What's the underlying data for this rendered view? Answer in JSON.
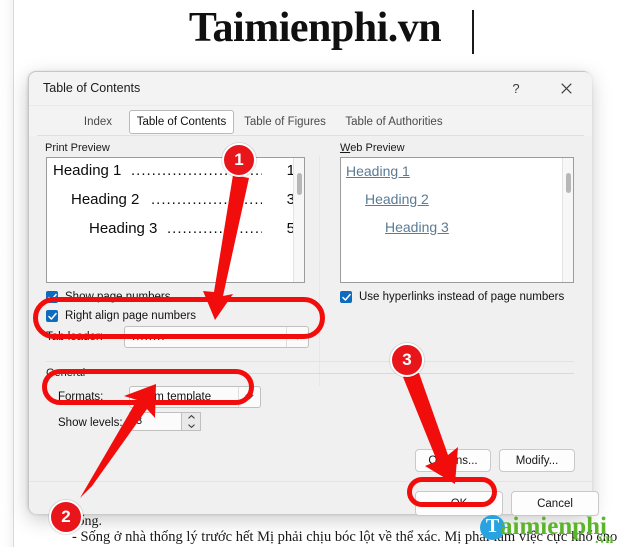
{
  "document": {
    "title": "Taimienphi.vn",
    "line1": "sống.",
    "line2": "- Sống ở nhà thống lý trước hết Mị phải chịu bóc lột về thể xác. Mị phải làm việc cực khổ cho"
  },
  "watermark": {
    "letter": "T",
    "name": "aimienphi",
    "tld": ".vn",
    "circle_color": "#29a3e0",
    "text_color": "#5bb52a"
  },
  "dialog": {
    "title": "Table of Contents",
    "help_icon": "question-mark-icon",
    "close_icon": "close-icon",
    "tabs": [
      {
        "label": "Index",
        "selected": false
      },
      {
        "label": "Table of Contents",
        "selected": true
      },
      {
        "label": "Table of Figures",
        "selected": false
      },
      {
        "label": "Table of Authorities",
        "selected": false
      }
    ],
    "print_preview": {
      "label": "Print Preview",
      "rows": [
        {
          "heading": "Heading 1",
          "dots": "...........................",
          "page": "1"
        },
        {
          "heading": "Heading 2",
          "dots": "........................",
          "page": "3"
        },
        {
          "heading": "Heading 3",
          "dots": ".....................",
          "page": "5"
        }
      ]
    },
    "web_preview": {
      "label": "Web Preview",
      "rows": [
        "Heading 1",
        "Heading 2",
        "Heading 3"
      ]
    },
    "checkboxes": {
      "show_page_numbers": {
        "label": "Show page numbers",
        "checked": true
      },
      "right_align_page_numbers": {
        "label": "Right align page numbers",
        "checked": true
      },
      "use_hyperlinks": {
        "label": "Use hyperlinks instead of page numbers",
        "checked": true
      }
    },
    "tab_leader": {
      "label": "Tab leader:",
      "value": "........"
    },
    "general": {
      "group_label": "General",
      "formats_label": "Formats:",
      "formats_value": "From template",
      "show_levels_label": "Show levels:",
      "show_levels_value": "3"
    },
    "buttons": {
      "options": "Options...",
      "modify": "Modify...",
      "ok": "OK",
      "cancel": "Cancel"
    }
  },
  "annotations": {
    "badge_1": "1",
    "badge_2": "2",
    "badge_3": "3",
    "accent_color": "#e8161b"
  }
}
